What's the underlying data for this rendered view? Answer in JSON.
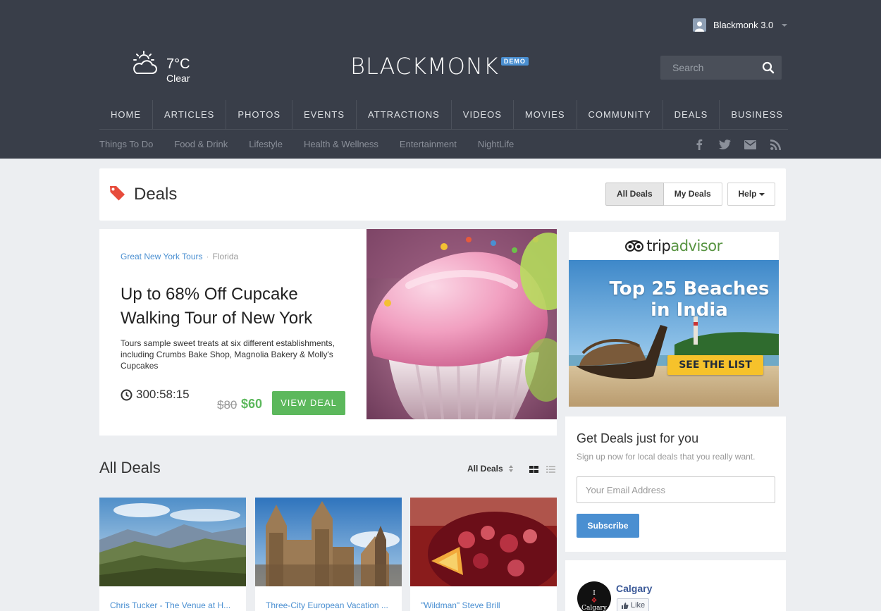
{
  "user": {
    "name": "Blackmonk 3.0"
  },
  "weather": {
    "temp": "7°C",
    "condition": "Clear"
  },
  "brand": {
    "name": "BLACKMONK",
    "badge": "DEMO"
  },
  "search": {
    "placeholder": "Search"
  },
  "main_nav": [
    "HOME",
    "ARTICLES",
    "PHOTOS",
    "EVENTS",
    "ATTRACTIONS",
    "VIDEOS",
    "MOVIES",
    "COMMUNITY",
    "DEALS",
    "BUSINESS"
  ],
  "sub_nav": [
    "Things To Do",
    "Food & Drink",
    "Lifestyle",
    "Health & Wellness",
    "Entertainment",
    "NightLife"
  ],
  "social_icons": [
    "facebook-icon",
    "twitter-icon",
    "mail-icon",
    "rss-icon"
  ],
  "deals_header": {
    "title": "Deals",
    "tabs": [
      {
        "label": "All Deals",
        "active": true
      },
      {
        "label": "My Deals",
        "active": false
      }
    ],
    "help_label": "Help"
  },
  "featured": {
    "vendor": "Great New York Tours",
    "location": "Florida",
    "title": "Up to 68% Off Cupcake Walking Tour of New York",
    "description": "Tours sample sweet treats at six different establishments, including Crumbs Bake Shop, Magnolia Bakery & Molly's Cupcakes",
    "timer": "300:58:15",
    "old_price": "$80",
    "new_price": "$60",
    "cta": "VIEW DEAL"
  },
  "all_deals": {
    "title": "All Deals",
    "sort_label": "All Deals",
    "cards": [
      {
        "title": "Chris Tucker - The Venue at H..."
      },
      {
        "title": "Three-City European Vacation ..."
      },
      {
        "title": "\"Wildman\" Steve Brill"
      }
    ]
  },
  "ad": {
    "brand_prefix": "trip",
    "brand_suffix": "advisor",
    "headline_1": "Top 25 Beaches",
    "headline_2": "in India",
    "cta": "SEE THE LIST"
  },
  "newsletter": {
    "title": "Get Deals just for you",
    "subtitle": "Sign up now for local deals that you really want.",
    "email_placeholder": "Your Email Address",
    "button": "Subscribe"
  },
  "facebook": {
    "page_name": "Calgary",
    "like_label": "Like",
    "avatar_line1": "I",
    "avatar_line2": "Calgary"
  },
  "colors": {
    "header_bg": "#393e49",
    "accent_blue": "#4a8fd1",
    "accent_green": "#5cb85c",
    "tag_red": "#e74c3c"
  }
}
